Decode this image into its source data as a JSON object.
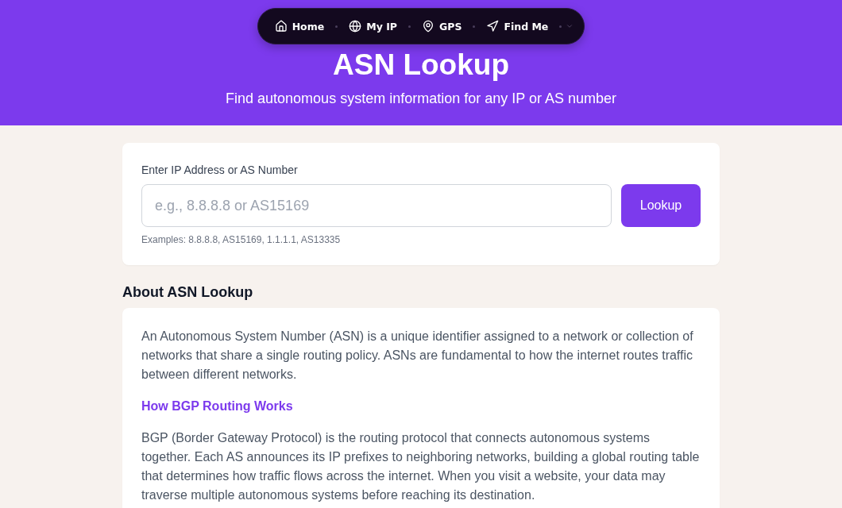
{
  "nav": {
    "items": [
      {
        "label": "Home"
      },
      {
        "label": "My IP"
      },
      {
        "label": "GPS"
      },
      {
        "label": "Find Me"
      }
    ]
  },
  "header": {
    "title": "ASN Lookup",
    "subtitle": "Find autonomous system information for any IP or AS number"
  },
  "lookup": {
    "label": "Enter IP Address or AS Number",
    "placeholder": "e.g., 8.8.8.8 or AS15169",
    "button": "Lookup",
    "examples": "Examples: 8.8.8.8, AS15169, 1.1.1.1, AS13335"
  },
  "about": {
    "heading": "About ASN Lookup",
    "blocks": [
      {
        "kind": "paragraph",
        "text": "An Autonomous System Number (ASN) is a unique identifier assigned to a network or collection of networks that share a single routing policy. ASNs are fundamental to how the internet routes traffic between different networks."
      },
      {
        "kind": "subheading",
        "text": "How BGP Routing Works"
      },
      {
        "kind": "paragraph",
        "text": "BGP (Border Gateway Protocol) is the routing protocol that connects autonomous systems together. Each AS announces its IP prefixes to neighboring networks, building a global routing table that determines how traffic flows across the internet. When you visit a website, your data may traverse multiple autonomous systems before reaching its destination."
      }
    ]
  }
}
